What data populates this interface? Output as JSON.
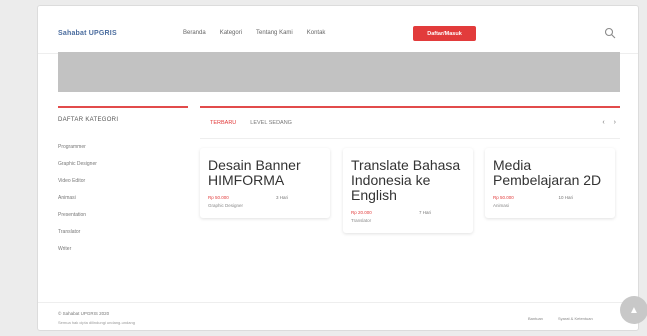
{
  "header": {
    "logo": "Sahabat UPGRIS",
    "nav": [
      "Beranda",
      "Kategori",
      "Tentang Kami",
      "Kontak"
    ],
    "cta": "Daftar/Masuk",
    "search_icon": "search-icon"
  },
  "sidebar": {
    "title": "DAFTAR KATEGORI",
    "categories": [
      "Programmer",
      "Graphic Designer",
      "Video Editor",
      "Animasi",
      "Presentation",
      "Translator",
      "Writer"
    ]
  },
  "main": {
    "tabs": [
      "TERBARU",
      "LEVEL SEDANG"
    ],
    "arrows": [
      "‹",
      "›"
    ],
    "cards": [
      {
        "title": "Desain Banner HIMFORMA",
        "price": "Rp 50.000",
        "time": "3 Hari",
        "category": "Graphic Designer"
      },
      {
        "title": "Translate Bahasa Indonesia ke English",
        "price": "Rp 20.000",
        "time": "7 Hari",
        "category": "Translator"
      },
      {
        "title": "Media Pembelajaran 2D",
        "price": "Rp 50.000",
        "time": "10 Hari",
        "category": "Animasi"
      }
    ]
  },
  "footer": {
    "copyright": "© Sahabat UPGRIS 2020",
    "credit": "Semua hak cipta dilindungi undang-undang",
    "links": [
      "Bantuan",
      "Syarat & Ketentuan"
    ]
  },
  "colors": {
    "accent": "#e23b3b",
    "logo": "#4a6c9e",
    "banner": "#c2c2c2"
  }
}
